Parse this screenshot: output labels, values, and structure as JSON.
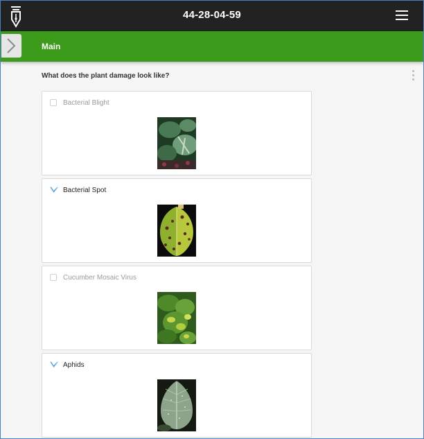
{
  "header": {
    "title": "44-28-04-59"
  },
  "section": {
    "title": "Main"
  },
  "question": {
    "text": "What does the plant damage look like?"
  },
  "options": [
    {
      "label": "Bacterial Blight",
      "selected": false,
      "image": "bacterial-blight-leaf-photo"
    },
    {
      "label": "Bacterial Spot",
      "selected": true,
      "image": "bacterial-spot-leaf-photo"
    },
    {
      "label": "Cucumber Mosaic Virus",
      "selected": false,
      "image": "cucumber-mosaic-virus-leaf-photo"
    },
    {
      "label": "Aphids",
      "selected": true,
      "image": "aphids-leaf-photo"
    }
  ],
  "colors": {
    "topbar": "#222222",
    "section_bar": "#3d9b1b",
    "check_accent": "#2f8fd8"
  }
}
